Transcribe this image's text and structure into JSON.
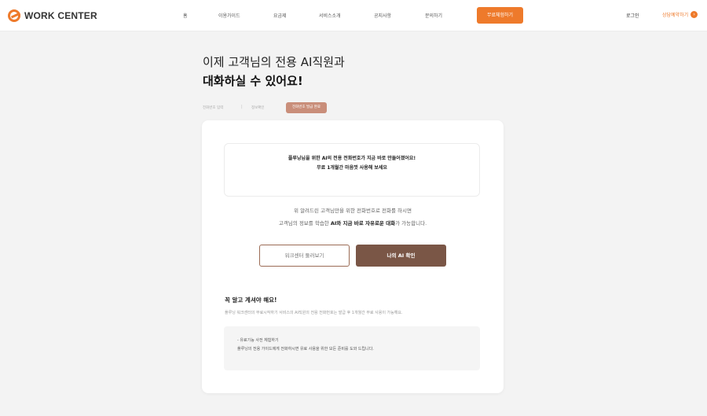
{
  "header": {
    "logo_text": "WORK CENTER",
    "nav": [
      {
        "label": "홈"
      },
      {
        "label": "이용가이드"
      },
      {
        "label": "요금제"
      },
      {
        "label": "서비스소개"
      },
      {
        "label": "공지사항"
      },
      {
        "label": "문의하기"
      }
    ],
    "cta_label": "무료체험하기",
    "login_label": "로그인",
    "consult_label": "상담예약하기",
    "accent_color": "#ee7a2b"
  },
  "hero": {
    "line1": "이제 고객님의 전용 AI직원과",
    "line2": "대화하실 수 있어요!"
  },
  "steps": {
    "step1": "전화번호 입력",
    "step2": "정보확인",
    "step3": "전화번호 발급 완료"
  },
  "card": {
    "notice_line1": "플루닝님을 위한 AI의 전용 전화번호가 지금 바로 만들어졌어요!",
    "notice_line2": "무료 1개월간 마음껏 사용해 보세요",
    "desc_line1": "위 알려드린 고객님만을 위한 전화번호로 전화를 하시면",
    "desc_line2_prefix": "고객님의 정보를 학습한 ",
    "desc_line2_bold": "AI와 지금 바로 자유로운 대화",
    "desc_line2_suffix": "가 가능합니다.",
    "btn_outline_label": "워크센터 둘러보기",
    "btn_fill_label": "나의 AI 확인",
    "must_title": "꼭 알고 계셔야 해요!",
    "must_desc": "플루닝 워크센터의 무료시작하기 서비스의 AI직원의 전용 전화번호는 발급 후 1개월간 무료 사용이 가능해요.",
    "info_line1": "- 유료기능 사전 체험하기",
    "info_line2": "플루닝의 전용 가이드에게 전화하시면 유료 사용을 위한 모든 준비를 도와 드립니다."
  }
}
